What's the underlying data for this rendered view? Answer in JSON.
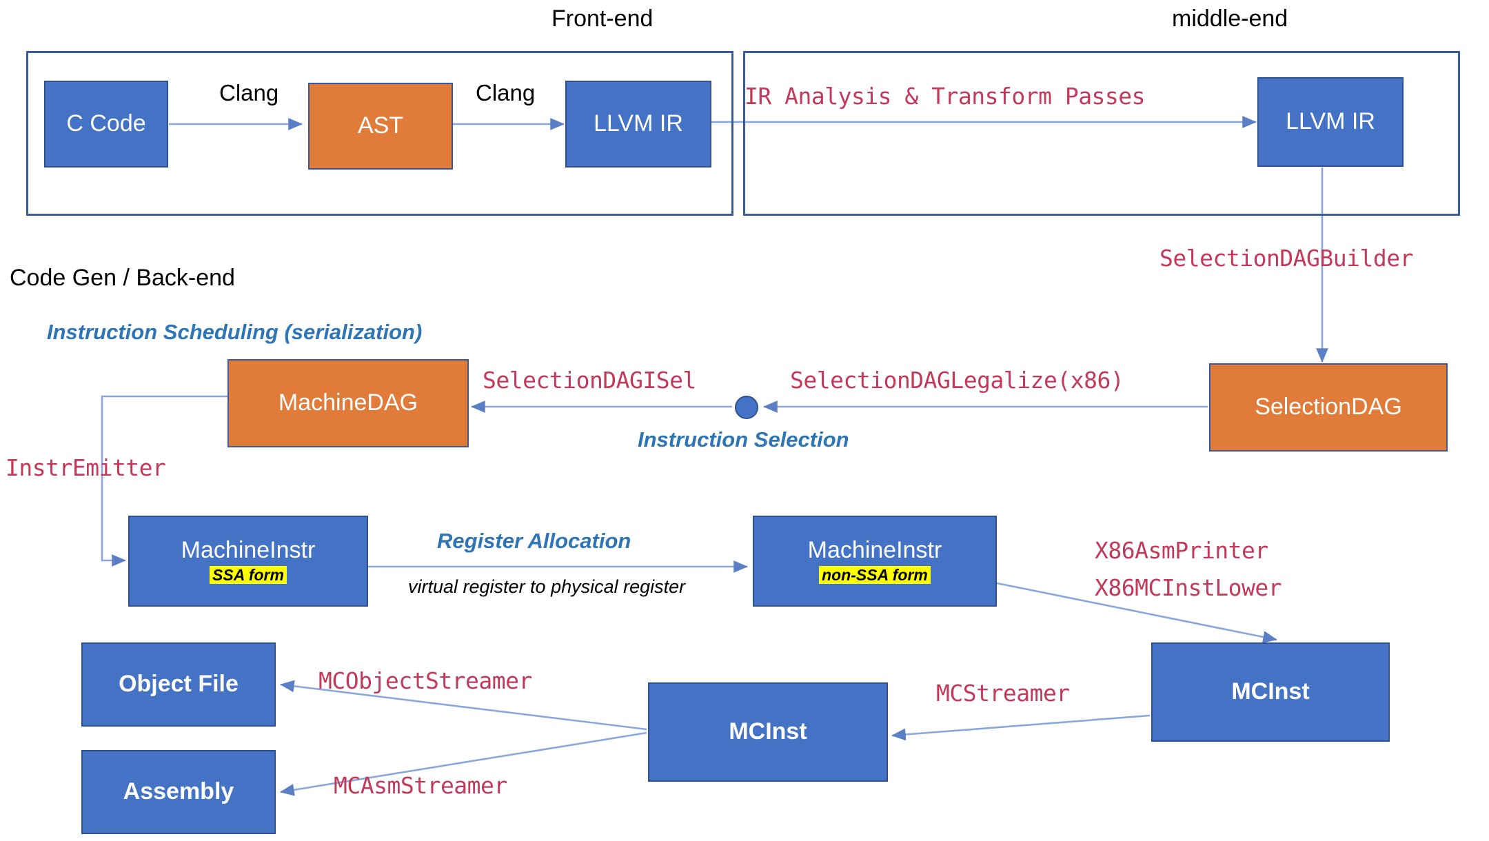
{
  "diagram": {
    "title": "LLVM Compilation Pipeline",
    "colors": {
      "node_blue": "#4472C4",
      "node_orange": "#E07B39",
      "code_label_red": "#C2395B",
      "phase_label_blue": "#2E75B6",
      "highlight_yellow": "#FFFF00",
      "group_border": "#3A5A9B",
      "arrow": "#6F8FCB"
    },
    "groups": [
      {
        "id": "front-end",
        "title": "Front-end"
      },
      {
        "id": "middle-end",
        "title": "middle-end"
      }
    ],
    "section_titles": [
      {
        "id": "codegen",
        "text": "Code Gen / Back-end"
      }
    ],
    "nodes": [
      {
        "id": "c-code",
        "label": "C Code",
        "sub": "",
        "color": "blue",
        "bold": false
      },
      {
        "id": "ast",
        "label": "AST",
        "sub": "",
        "color": "orange",
        "bold": false
      },
      {
        "id": "llvm-ir-front",
        "label": "LLVM IR",
        "sub": "",
        "color": "blue",
        "bold": false
      },
      {
        "id": "llvm-ir-middle",
        "label": "LLVM IR",
        "sub": "",
        "color": "blue",
        "bold": false
      },
      {
        "id": "selection-dag",
        "label": "SelectionDAG",
        "sub": "",
        "color": "orange",
        "bold": false
      },
      {
        "id": "machine-dag",
        "label": "MachineDAG",
        "sub": "",
        "color": "orange",
        "bold": false
      },
      {
        "id": "machine-instr-ssa",
        "label": "MachineInstr",
        "sub": "SSA form",
        "color": "blue",
        "bold": false
      },
      {
        "id": "machine-instr-nonssa",
        "label": "MachineInstr",
        "sub": "non-SSA form",
        "color": "blue",
        "bold": false
      },
      {
        "id": "mcinst-right",
        "label": "MCInst",
        "sub": "",
        "color": "blue",
        "bold": true
      },
      {
        "id": "mcinst-center",
        "label": "MCInst",
        "sub": "",
        "color": "blue",
        "bold": true
      },
      {
        "id": "object-file",
        "label": "Object File",
        "sub": "",
        "color": "blue",
        "bold": true
      },
      {
        "id": "assembly",
        "label": "Assembly",
        "sub": "",
        "color": "blue",
        "bold": true
      }
    ],
    "junction": {
      "id": "instruction-selection-dot"
    },
    "edge_labels": {
      "clang_1": "Clang",
      "clang_2": "Clang",
      "ir_passes": "IR Analysis & Transform Passes",
      "selection_dag_builder": "SelectionDAGBuilder",
      "selection_dag_legalize": "SelectionDAGLegalize(x86)",
      "selection_dag_isel": "SelectionDAGISel",
      "instr_emitter": "InstrEmitter",
      "x86_asm_printer": "X86AsmPrinter",
      "x86_mcinst_lower": "X86MCInstLower",
      "mc_streamer": "MCStreamer",
      "mc_object_streamer": "MCObjectStreamer",
      "mc_asm_streamer": "MCAsmStreamer"
    },
    "phase_labels": {
      "instruction_scheduling": "Instruction Scheduling (serialization)",
      "instruction_selection": "Instruction Selection",
      "register_allocation": "Register Allocation"
    },
    "notes": {
      "register_allocation_note": "virtual register to physical register"
    }
  }
}
